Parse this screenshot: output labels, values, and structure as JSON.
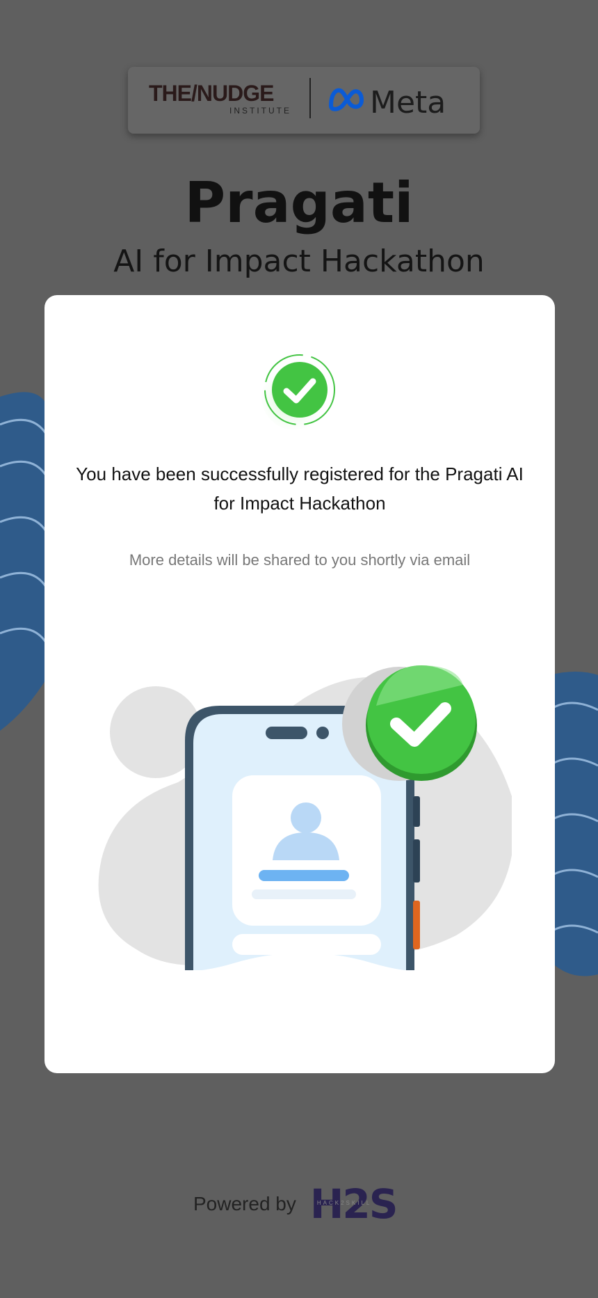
{
  "header": {
    "nudge_logo_main": "THE/NUDGE",
    "nudge_logo_sub": "INSTITUTE",
    "meta_logo": "Meta"
  },
  "hero": {
    "title": "Pragati",
    "subtitle": "AI for Impact Hackathon"
  },
  "modal": {
    "message": "You have been successfully registered for the Pragati AI for Impact Hackathon",
    "note": "More details will be shared to you shortly via email"
  },
  "footer": {
    "powered_by": "Powered by",
    "h2s_logo": "H2S",
    "h2s_tagline": "HACK2SKILL"
  },
  "colors": {
    "success_green": "#43c443",
    "phone_frame": "#3d5569",
    "phone_screen": "#dff0fc",
    "accent_blue": "#6db3f2"
  }
}
